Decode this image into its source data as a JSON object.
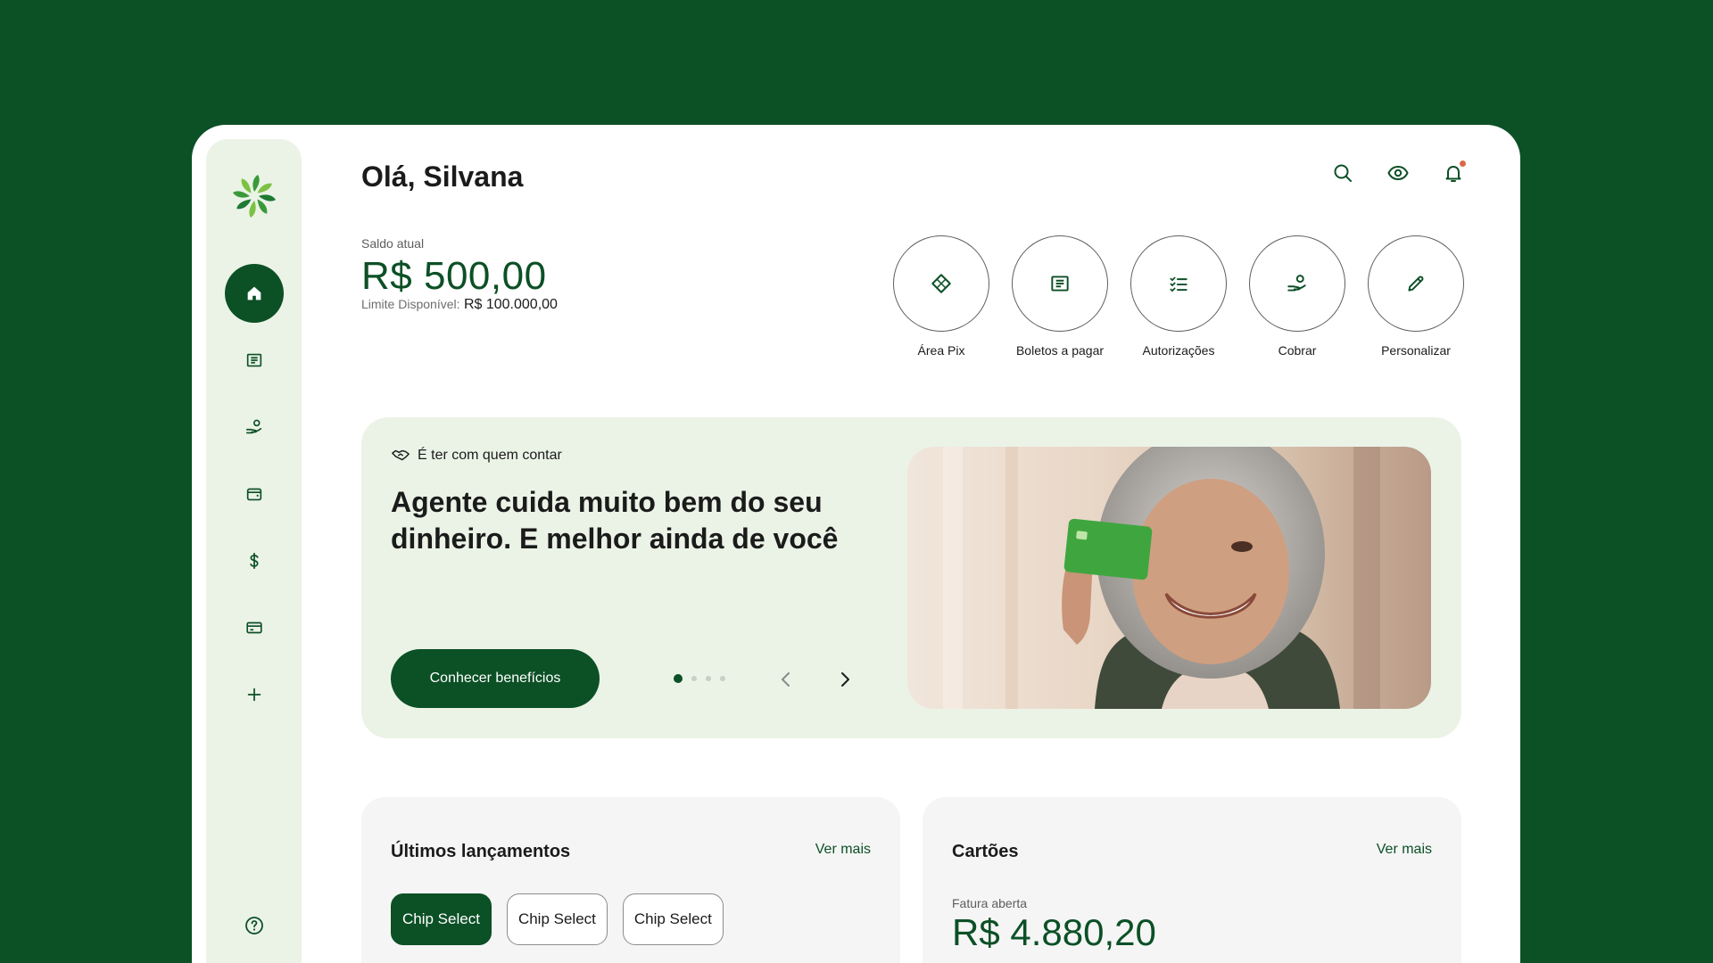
{
  "greeting": "Olá, Silvana",
  "balance": {
    "label": "Saldo atual",
    "value": "R$ 500,00",
    "limit_label": "Limite Disponível:",
    "limit_value": "R$ 100.000,00"
  },
  "quick_actions": [
    {
      "label": "Área Pix",
      "icon": "pix-icon"
    },
    {
      "label": "Boletos a pagar",
      "icon": "receipt-icon"
    },
    {
      "label": "Autorizações",
      "icon": "checklist-icon"
    },
    {
      "label": "Cobrar",
      "icon": "hand-coin-icon"
    },
    {
      "label": "Personalizar",
      "icon": "pencil-icon"
    }
  ],
  "sidebar": {
    "items": [
      {
        "icon": "home-icon",
        "active": true
      },
      {
        "icon": "receipt-icon"
      },
      {
        "icon": "hand-coin-icon"
      },
      {
        "icon": "wallet-icon"
      },
      {
        "icon": "dollar-icon"
      },
      {
        "icon": "card-icon"
      },
      {
        "icon": "plus-icon"
      }
    ],
    "help_icon": "help-icon"
  },
  "banner": {
    "tagline": "É ter com quem contar",
    "headline": "Agente cuida muito bem do seu dinheiro. E melhor ainda de você",
    "cta": "Conhecer benefícios",
    "slides": 4,
    "current_slide": 1
  },
  "recent": {
    "title": "Últimos lançamentos",
    "more": "Ver mais",
    "chips": [
      {
        "label": "Chip Select",
        "selected": true
      },
      {
        "label": "Chip Select",
        "selected": false
      },
      {
        "label": "Chip Select",
        "selected": false
      }
    ]
  },
  "cards": {
    "title": "Cartões",
    "more": "Ver mais",
    "invoice_label": "Fatura aberta",
    "invoice_value": "R$ 4.880,20"
  },
  "colors": {
    "brand": "#0c5026",
    "soft": "#ebf3e7",
    "notification": "#d9694a"
  }
}
